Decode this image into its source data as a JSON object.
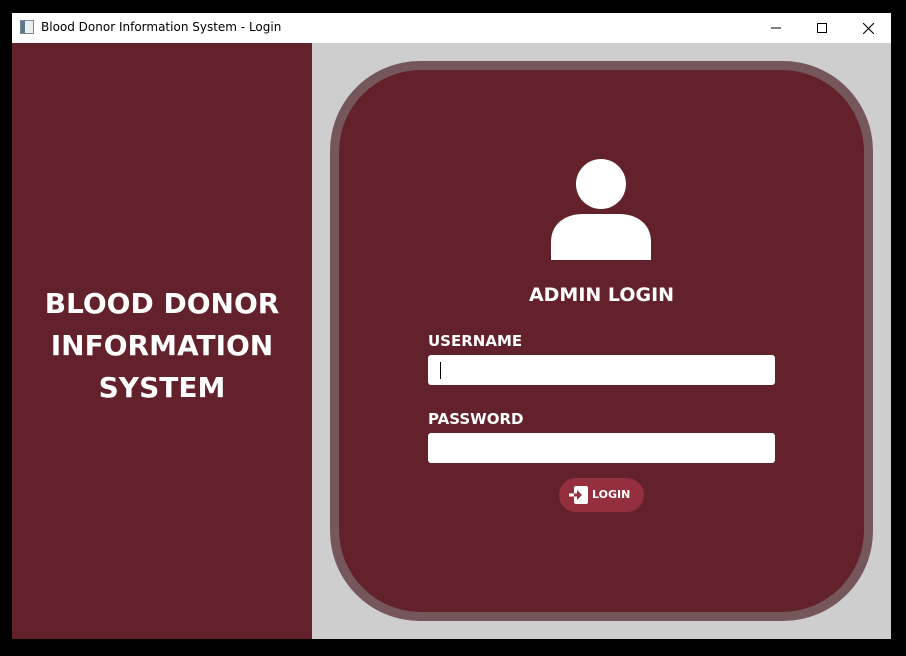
{
  "window": {
    "title": "Blood Donor Information System - Login",
    "app_icon": "app-window-icon",
    "controls": {
      "minimize_icon": "minimize-icon",
      "maximize_icon": "maximize-icon",
      "close_icon": "close-icon"
    }
  },
  "sidebar": {
    "title_lines": [
      "BLOOD DONOR",
      "INFORMATION",
      "SYSTEM"
    ]
  },
  "login": {
    "avatar_icon": "user-icon",
    "heading": "ADMIN LOGIN",
    "username_label": "USERNAME",
    "username_value": "",
    "password_label": "PASSWORD",
    "password_value": "",
    "button_label": "LOGIN",
    "button_icon": "sign-in-icon"
  },
  "colors": {
    "primary": "#63212b",
    "card_border": "#75565a",
    "button": "#942f3f",
    "background": "#cecece",
    "text": "#ffffff"
  }
}
